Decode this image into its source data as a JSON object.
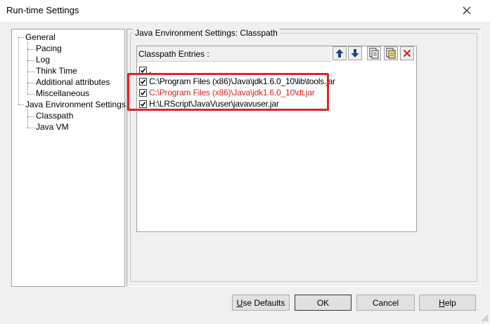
{
  "window": {
    "title": "Run-time Settings"
  },
  "tree": {
    "items": [
      {
        "label": "General"
      },
      {
        "label": "Pacing"
      },
      {
        "label": "Log"
      },
      {
        "label": "Think Time"
      },
      {
        "label": "Additional attributes"
      },
      {
        "label": "Miscellaneous"
      },
      {
        "label": "Java Environment Settings"
      },
      {
        "label": "Classpath"
      },
      {
        "label": "Java VM"
      }
    ]
  },
  "group": {
    "title": "Java Environment Settings: Classpath"
  },
  "classpath": {
    "header": "Classpath Entries :",
    "toolbar": {
      "move_up_icon": "arrow-up-icon",
      "move_down_icon": "arrow-down-icon",
      "browse_icon": "browse-file-icon",
      "edit_icon": "edit-entry-icon",
      "delete_icon": "delete-icon"
    },
    "entries": [
      {
        "path": ".",
        "checked": true,
        "color": "#000000"
      },
      {
        "path": "C:\\Program Files (x86)\\Java\\jdk1.6.0_10\\lib\\tools.jar",
        "checked": true,
        "color": "#000000"
      },
      {
        "path": "C:\\Program Files (x86)\\Java\\jdk1.6.0_10\\dt.jar",
        "checked": true,
        "color": "#e02020"
      },
      {
        "path": "H:\\LRScript\\JavaVuser\\javavuser.jar",
        "checked": true,
        "color": "#000000"
      }
    ]
  },
  "buttons": {
    "use_defaults": {
      "pre": "",
      "key": "U",
      "post": "se Defaults"
    },
    "ok": "OK",
    "cancel": "Cancel",
    "help": {
      "pre": "",
      "key": "H",
      "post": "elp"
    }
  },
  "colors": {
    "highlight": "#e0242c",
    "accent_arrow": "#1f3f9f"
  }
}
